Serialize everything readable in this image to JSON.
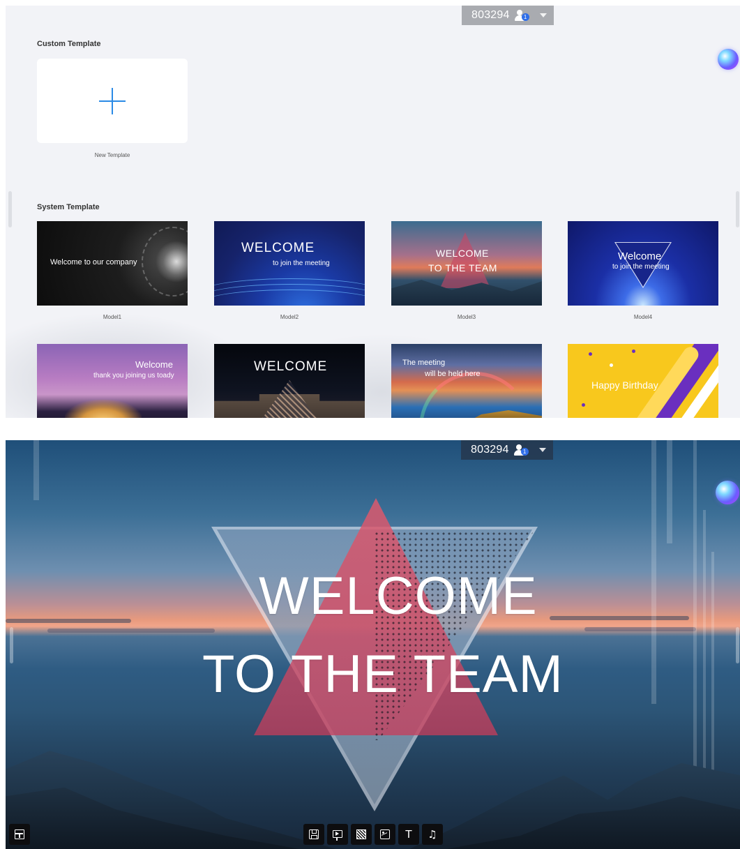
{
  "meeting_bar": {
    "meeting_id": "803294",
    "participant_count": "1"
  },
  "template_picker": {
    "custom_section_title": "Custom Template",
    "new_template_label": "New Template",
    "system_section_title": "System Template",
    "templates": [
      {
        "caption": "Model1",
        "line1": "Welcome to our company",
        "line2": ""
      },
      {
        "caption": "Model2",
        "line1": "WELCOME",
        "line2": "to join the meeting"
      },
      {
        "caption": "Model3",
        "line1": "WELCOME",
        "line2": "TO THE TEAM"
      },
      {
        "caption": "Model4",
        "line1": "Welcome",
        "line2": "to join the meeting"
      },
      {
        "caption": "",
        "line1": "Welcome",
        "line2": "thank you joining us toady"
      },
      {
        "caption": "",
        "line1": "WELCOME",
        "line2": ""
      },
      {
        "caption": "",
        "line1": "The meeting",
        "line2": "will be held here"
      },
      {
        "caption": "",
        "line1": "Happy Birthday",
        "line2": ""
      }
    ]
  },
  "preview": {
    "title_line1": "WELCOME",
    "title_line2": "TO THE TEAM",
    "toolbar": [
      {
        "name": "save-icon"
      },
      {
        "name": "present-icon"
      },
      {
        "name": "background-icon"
      },
      {
        "name": "image-icon"
      },
      {
        "name": "text-icon",
        "glyph": "T"
      },
      {
        "name": "music-icon",
        "glyph": "♫"
      }
    ],
    "layout_icon": "layout-icon"
  },
  "colors": {
    "accent": "#2a8ae6",
    "badge": "#2f6ee8"
  }
}
